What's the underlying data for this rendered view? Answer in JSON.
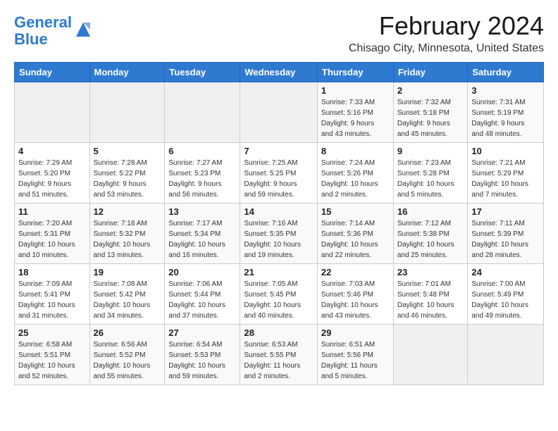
{
  "logo": {
    "line1": "General",
    "line2": "Blue"
  },
  "title": "February 2024",
  "subtitle": "Chisago City, Minnesota, United States",
  "days_of_week": [
    "Sunday",
    "Monday",
    "Tuesday",
    "Wednesday",
    "Thursday",
    "Friday",
    "Saturday"
  ],
  "weeks": [
    [
      {
        "day": "",
        "info": ""
      },
      {
        "day": "",
        "info": ""
      },
      {
        "day": "",
        "info": ""
      },
      {
        "day": "",
        "info": ""
      },
      {
        "day": "1",
        "info": "Sunrise: 7:33 AM\nSunset: 5:16 PM\nDaylight: 9 hours\nand 43 minutes."
      },
      {
        "day": "2",
        "info": "Sunrise: 7:32 AM\nSunset: 5:18 PM\nDaylight: 9 hours\nand 45 minutes."
      },
      {
        "day": "3",
        "info": "Sunrise: 7:31 AM\nSunset: 5:19 PM\nDaylight: 9 hours\nand 48 minutes."
      }
    ],
    [
      {
        "day": "4",
        "info": "Sunrise: 7:29 AM\nSunset: 5:20 PM\nDaylight: 9 hours\nand 51 minutes."
      },
      {
        "day": "5",
        "info": "Sunrise: 7:28 AM\nSunset: 5:22 PM\nDaylight: 9 hours\nand 53 minutes."
      },
      {
        "day": "6",
        "info": "Sunrise: 7:27 AM\nSunset: 5:23 PM\nDaylight: 9 hours\nand 56 minutes."
      },
      {
        "day": "7",
        "info": "Sunrise: 7:25 AM\nSunset: 5:25 PM\nDaylight: 9 hours\nand 59 minutes."
      },
      {
        "day": "8",
        "info": "Sunrise: 7:24 AM\nSunset: 5:26 PM\nDaylight: 10 hours\nand 2 minutes."
      },
      {
        "day": "9",
        "info": "Sunrise: 7:23 AM\nSunset: 5:28 PM\nDaylight: 10 hours\nand 5 minutes."
      },
      {
        "day": "10",
        "info": "Sunrise: 7:21 AM\nSunset: 5:29 PM\nDaylight: 10 hours\nand 7 minutes."
      }
    ],
    [
      {
        "day": "11",
        "info": "Sunrise: 7:20 AM\nSunset: 5:31 PM\nDaylight: 10 hours\nand 10 minutes."
      },
      {
        "day": "12",
        "info": "Sunrise: 7:18 AM\nSunset: 5:32 PM\nDaylight: 10 hours\nand 13 minutes."
      },
      {
        "day": "13",
        "info": "Sunrise: 7:17 AM\nSunset: 5:34 PM\nDaylight: 10 hours\nand 16 minutes."
      },
      {
        "day": "14",
        "info": "Sunrise: 7:16 AM\nSunset: 5:35 PM\nDaylight: 10 hours\nand 19 minutes."
      },
      {
        "day": "15",
        "info": "Sunrise: 7:14 AM\nSunset: 5:36 PM\nDaylight: 10 hours\nand 22 minutes."
      },
      {
        "day": "16",
        "info": "Sunrise: 7:12 AM\nSunset: 5:38 PM\nDaylight: 10 hours\nand 25 minutes."
      },
      {
        "day": "17",
        "info": "Sunrise: 7:11 AM\nSunset: 5:39 PM\nDaylight: 10 hours\nand 28 minutes."
      }
    ],
    [
      {
        "day": "18",
        "info": "Sunrise: 7:09 AM\nSunset: 5:41 PM\nDaylight: 10 hours\nand 31 minutes."
      },
      {
        "day": "19",
        "info": "Sunrise: 7:08 AM\nSunset: 5:42 PM\nDaylight: 10 hours\nand 34 minutes."
      },
      {
        "day": "20",
        "info": "Sunrise: 7:06 AM\nSunset: 5:44 PM\nDaylight: 10 hours\nand 37 minutes."
      },
      {
        "day": "21",
        "info": "Sunrise: 7:05 AM\nSunset: 5:45 PM\nDaylight: 10 hours\nand 40 minutes."
      },
      {
        "day": "22",
        "info": "Sunrise: 7:03 AM\nSunset: 5:46 PM\nDaylight: 10 hours\nand 43 minutes."
      },
      {
        "day": "23",
        "info": "Sunrise: 7:01 AM\nSunset: 5:48 PM\nDaylight: 10 hours\nand 46 minutes."
      },
      {
        "day": "24",
        "info": "Sunrise: 7:00 AM\nSunset: 5:49 PM\nDaylight: 10 hours\nand 49 minutes."
      }
    ],
    [
      {
        "day": "25",
        "info": "Sunrise: 6:58 AM\nSunset: 5:51 PM\nDaylight: 10 hours\nand 52 minutes."
      },
      {
        "day": "26",
        "info": "Sunrise: 6:56 AM\nSunset: 5:52 PM\nDaylight: 10 hours\nand 55 minutes."
      },
      {
        "day": "27",
        "info": "Sunrise: 6:54 AM\nSunset: 5:53 PM\nDaylight: 10 hours\nand 59 minutes."
      },
      {
        "day": "28",
        "info": "Sunrise: 6:53 AM\nSunset: 5:55 PM\nDaylight: 11 hours\nand 2 minutes."
      },
      {
        "day": "29",
        "info": "Sunrise: 6:51 AM\nSunset: 5:56 PM\nDaylight: 11 hours\nand 5 minutes."
      },
      {
        "day": "",
        "info": ""
      },
      {
        "day": "",
        "info": ""
      }
    ]
  ]
}
